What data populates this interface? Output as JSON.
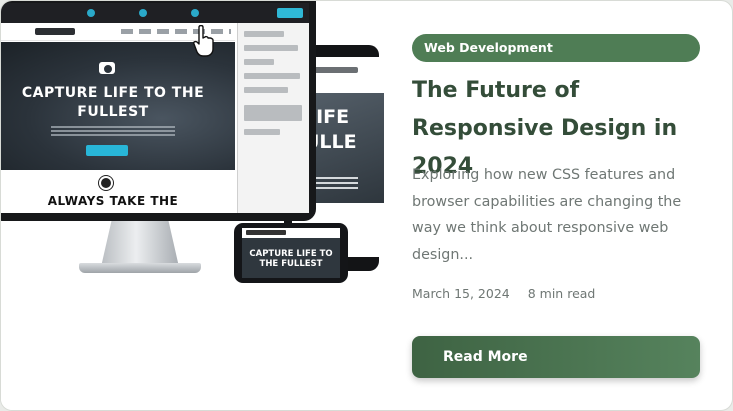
{
  "article": {
    "category": "Web Development",
    "title": "The Future of Responsive Design in 2024",
    "excerpt": "Exploring how new CSS features and browser capabilities are changing the way we think about responsive web design...",
    "date": "March 15, 2024",
    "read_time": "8 min read",
    "read_more_label": "Read More"
  },
  "illustration": {
    "monitor_headline": "CAPTURE LIFE TO THE FULLEST",
    "monitor_section_title": "ALWAYS TAKE THE",
    "tablet_headline": "LIFE ULLE",
    "phone_headline": "CAPTURE LIFE TO THE FULLEST"
  },
  "colors": {
    "accent": "#4f7d55",
    "title": "#344d39",
    "body_text": "#6f7774"
  }
}
